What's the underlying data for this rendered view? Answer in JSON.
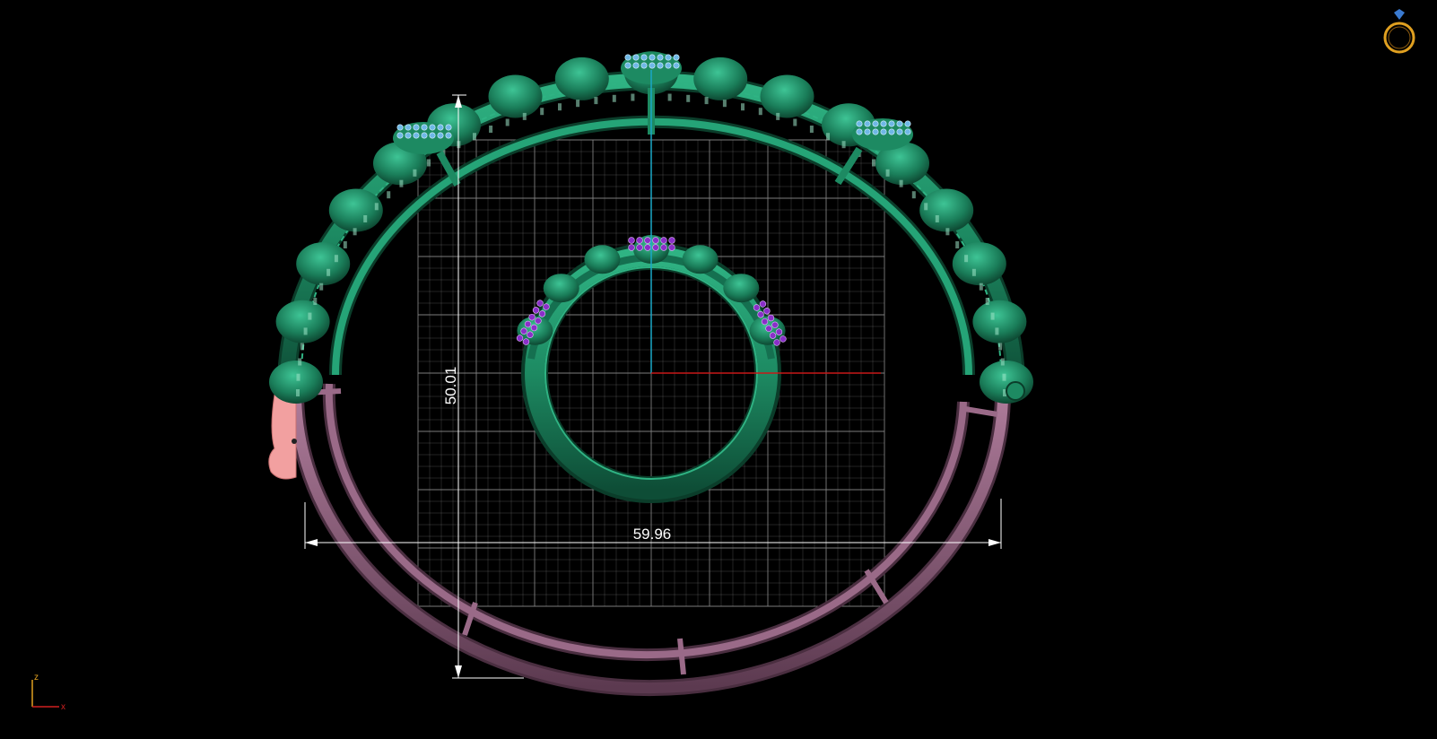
{
  "viewport": {
    "background": "#000000",
    "grid_color": "#8a8a8a",
    "outer_band_color": "#1d8a62",
    "outer_shank_color": "#8a5a78",
    "inner_ring_color": "#1d8a62",
    "outer_gem_color": "#6fb8e6",
    "inner_gem_color": "#8a2fc8",
    "hinge_color": "#f2a0a0"
  },
  "dimensions": {
    "width_label": "59.96",
    "height_label": "50.01"
  },
  "axes": {
    "z_label": "z",
    "x_label": "x",
    "z_color": "#e0a020",
    "x_color": "#d02020",
    "center_vertical_color": "#1aa8c8",
    "center_horizontal_color": "#c81818"
  },
  "toolbar": {
    "view_cube_icon": "ring-icon",
    "view_cube_color": "#e0a020",
    "view_cube_gem_color": "#3a7ad0"
  }
}
